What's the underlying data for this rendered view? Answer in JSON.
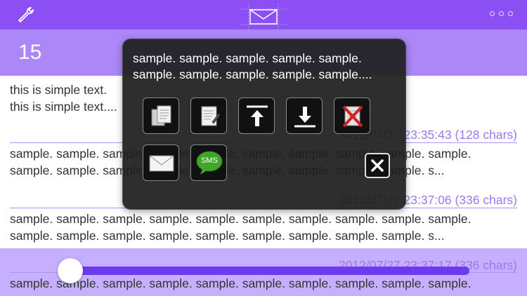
{
  "header": {
    "count": "15"
  },
  "items": [
    {
      "lines": [
        "this is simple text.",
        "this is simple text...."
      ]
    },
    {
      "timestamp": "2012/07/27 23:35:43 (128 chars)",
      "lines": [
        "sample. sample. sample. sample. sample. sample. sample. sample. sample. sample.",
        "sample. sample. sample. sample. sample. sample. sample. sample. sample. s..."
      ]
    },
    {
      "timestamp": "2012/07/27 23:37:06 (336 chars)",
      "lines": [
        "sample. sample. sample. sample. sample. sample. sample. sample. sample. sample.",
        "sample. sample. sample. sample. sample. sample. sample. sample. sample. s..."
      ]
    },
    {
      "timestamp": "2012/07/27 23:37:17 (336 chars)",
      "lines": [
        "sample. sample. sample. sample. sample. sample. sample. sample. sample. sample."
      ]
    }
  ],
  "popup": {
    "text_lines": [
      "sample. sample. sample. sample. sample.",
      "sample. sample. sample. sample. sample...."
    ],
    "sms_label": "SMS",
    "icons": [
      "copy-icon",
      "edit-icon",
      "move-top-icon",
      "move-bottom-icon",
      "delete-icon",
      "mail-icon",
      "sms-icon",
      "close-icon"
    ]
  },
  "slider": {
    "value": 0.0
  },
  "colors": {
    "header": "#8b4ff4",
    "accent": "#ac87f7",
    "timestamp": "#9a78ef",
    "sms_green": "#3ea62a"
  }
}
